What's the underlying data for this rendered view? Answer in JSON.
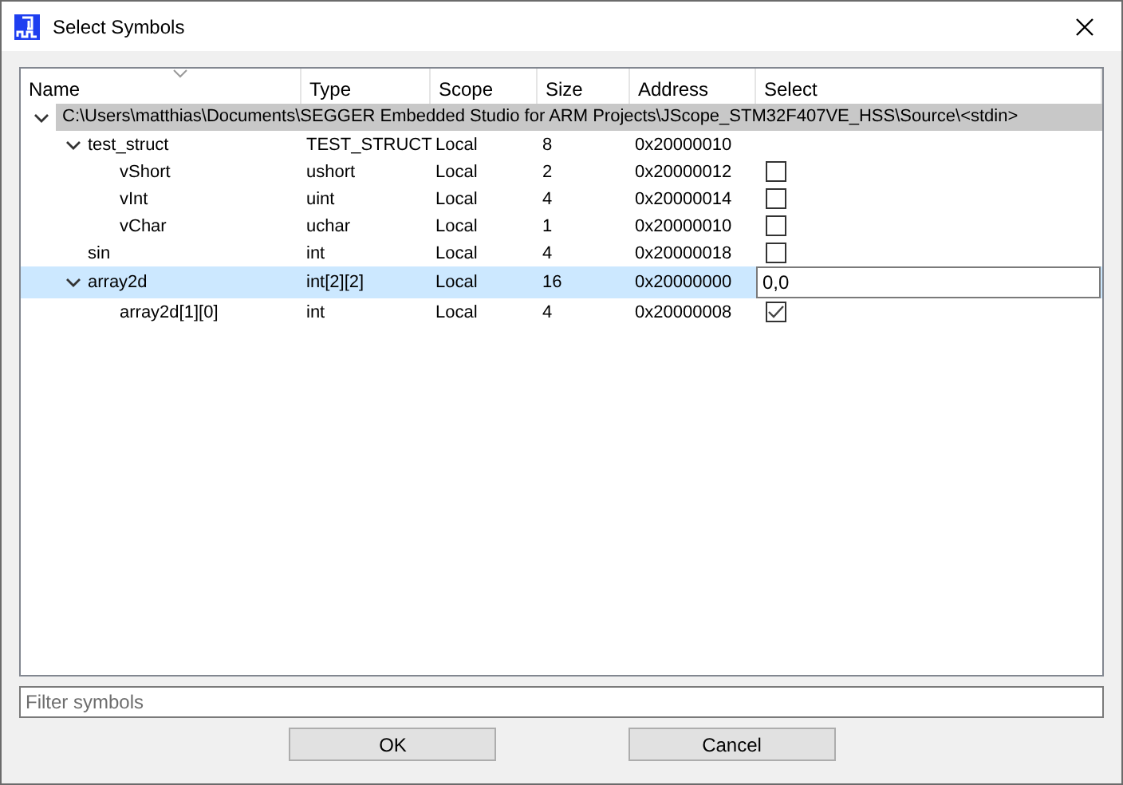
{
  "window": {
    "title": "Select Symbols"
  },
  "columns": [
    "Name",
    "Type",
    "Scope",
    "Size",
    "Address",
    "Select"
  ],
  "tree": [
    {
      "path": "C:\\Users\\matthias\\Documents\\SEGGER Embedded Studio for ARM Projects\\JScope_STM32F407VE_HSS\\Source\\<stdin>",
      "expanded": true,
      "children": [
        {
          "name": "test_struct",
          "type": "TEST_STRUCT",
          "scope": "Local",
          "size": "8",
          "address": "0x20000010",
          "selected": false,
          "expanded": true,
          "children": [
            {
              "name": "vShort",
              "type": "ushort",
              "scope": "Local",
              "size": "2",
              "address": "0x20000012",
              "selected": false,
              "select": {
                "kind": "checkbox",
                "checked": false
              }
            },
            {
              "name": "vInt",
              "type": "uint",
              "scope": "Local",
              "size": "4",
              "address": "0x20000014",
              "selected": false,
              "select": {
                "kind": "checkbox",
                "checked": false
              }
            },
            {
              "name": "vChar",
              "type": "uchar",
              "scope": "Local",
              "size": "1",
              "address": "0x20000010",
              "selected": false,
              "select": {
                "kind": "checkbox",
                "checked": false
              }
            }
          ]
        },
        {
          "name": "sin",
          "type": "int",
          "scope": "Local",
          "size": "4",
          "address": "0x20000018",
          "selected": false,
          "select": {
            "kind": "checkbox",
            "checked": false
          }
        },
        {
          "name": "array2d",
          "type": "int[2][2]",
          "scope": "Local",
          "size": "16",
          "address": "0x20000000",
          "selected": true,
          "select": {
            "kind": "input",
            "value": "0,0"
          },
          "expanded": true,
          "children": [
            {
              "name": "array2d[1][0]",
              "type": "int",
              "scope": "Local",
              "size": "4",
              "address": "0x20000008",
              "selected": false,
              "select": {
                "kind": "checkbox",
                "checked": true
              }
            }
          ]
        }
      ]
    }
  ],
  "filter": {
    "placeholder": "Filter symbols"
  },
  "buttons": [
    "OK",
    "Cancel"
  ]
}
